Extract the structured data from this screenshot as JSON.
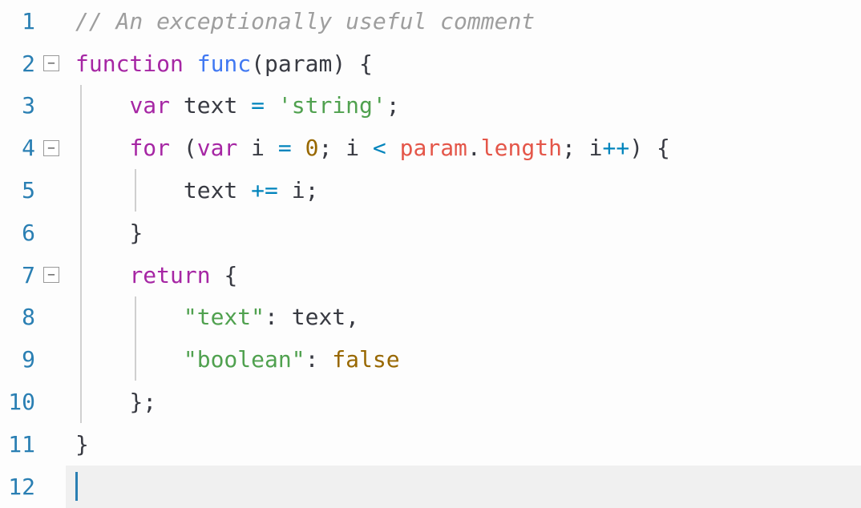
{
  "editor": {
    "line_numbers": [
      "1",
      "2",
      "3",
      "4",
      "5",
      "6",
      "7",
      "8",
      "9",
      "10",
      "11",
      "12"
    ],
    "fold_markers": {
      "2": "−",
      "4": "−",
      "7": "−"
    },
    "cursor_line": 12,
    "lines": {
      "l1": {
        "comment": "// An exceptionally useful comment"
      },
      "l2": {
        "kw_function": "function",
        "sp1": " ",
        "funcname": "func",
        "lparen": "(",
        "param": "param",
        "rparen": ")",
        "sp2": " ",
        "lbrace": "{"
      },
      "l3": {
        "indent": "    ",
        "kw_var": "var",
        "sp1": " ",
        "id_text": "text",
        "sp2": " ",
        "op_eq": "=",
        "sp3": " ",
        "str": "'string'",
        "semi": ";"
      },
      "l4": {
        "indent": "    ",
        "kw_for": "for",
        "sp1": " ",
        "lparen": "(",
        "kw_var": "var",
        "sp2": " ",
        "id_i": "i",
        "sp3": " ",
        "op_eq": "=",
        "sp4": " ",
        "num0": "0",
        "semi1": ";",
        "sp5": " ",
        "id_i2": "i",
        "sp6": " ",
        "op_lt": "<",
        "sp7": " ",
        "param": "param",
        "dot": ".",
        "prop": "length",
        "semi2": ";",
        "sp8": " ",
        "id_i3": "i",
        "op_inc": "++",
        "rparen": ")",
        "sp9": " ",
        "lbrace": "{"
      },
      "l5": {
        "indent": "        ",
        "id_text": "text",
        "sp1": " ",
        "op_pluseq": "+=",
        "sp2": " ",
        "id_i": "i",
        "semi": ";"
      },
      "l6": {
        "indent": "    ",
        "rbrace": "}"
      },
      "l7": {
        "indent": "    ",
        "kw_return": "return",
        "sp1": " ",
        "lbrace": "{"
      },
      "l8": {
        "indent": "        ",
        "key_text": "\"text\"",
        "colon": ":",
        "sp1": " ",
        "id_text": "text",
        "comma": ","
      },
      "l9": {
        "indent": "        ",
        "key_bool": "\"boolean\"",
        "colon": ":",
        "sp1": " ",
        "val_false": "false"
      },
      "l10": {
        "indent": "    ",
        "rbrace": "}",
        "semi": ";"
      },
      "l11": {
        "rbrace": "}"
      }
    }
  }
}
